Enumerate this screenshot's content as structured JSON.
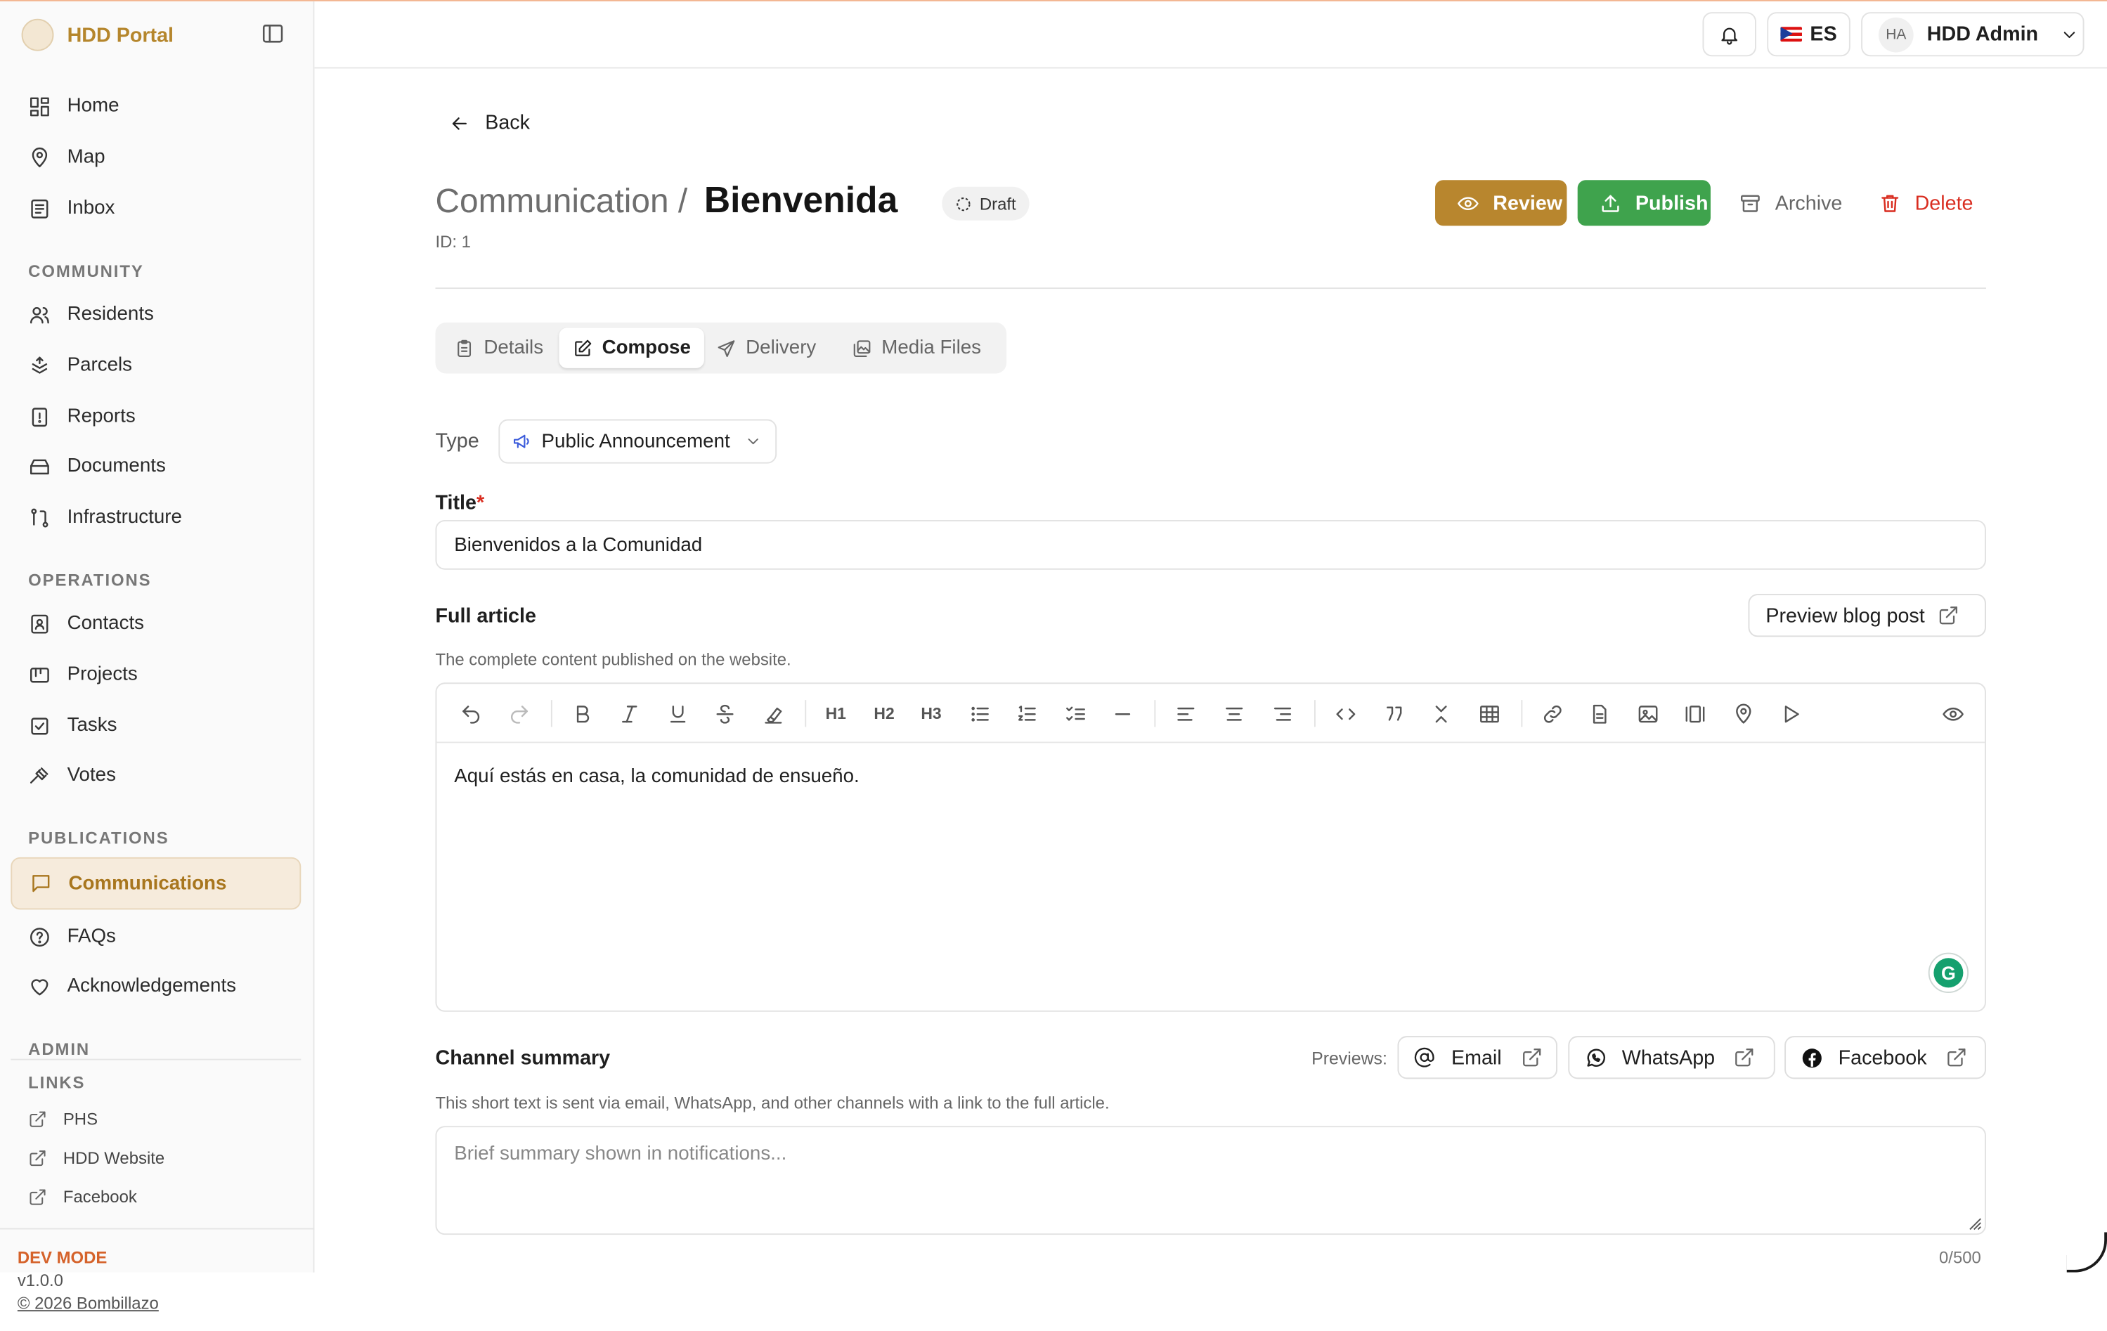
{
  "app": {
    "brand": "HDD Portal",
    "accent": "#b5862c",
    "dev_mode": "DEV MODE",
    "version": "v1.0.0",
    "copyright": "© 2026 Bombillazo"
  },
  "sidebar": {
    "main": [
      {
        "label": "Home",
        "icon": "home-icon"
      },
      {
        "label": "Map",
        "icon": "map-pin-icon"
      },
      {
        "label": "Inbox",
        "icon": "inbox-icon"
      }
    ],
    "community_label": "COMMUNITY",
    "community": [
      {
        "label": "Residents",
        "icon": "users-icon"
      },
      {
        "label": "Parcels",
        "icon": "parcels-icon"
      },
      {
        "label": "Reports",
        "icon": "report-icon"
      },
      {
        "label": "Documents",
        "icon": "documents-icon"
      },
      {
        "label": "Infrastructure",
        "icon": "infrastructure-icon"
      }
    ],
    "operations_label": "OPERATIONS",
    "operations": [
      {
        "label": "Contacts",
        "icon": "contacts-icon"
      },
      {
        "label": "Projects",
        "icon": "projects-icon"
      },
      {
        "label": "Tasks",
        "icon": "tasks-icon"
      },
      {
        "label": "Votes",
        "icon": "gavel-icon"
      }
    ],
    "publications_label": "PUBLICATIONS",
    "publications": [
      {
        "label": "Communications",
        "icon": "message-icon",
        "active": true
      },
      {
        "label": "FAQs",
        "icon": "help-icon"
      },
      {
        "label": "Acknowledgements",
        "icon": "heart-icon"
      }
    ],
    "admin_label": "ADMIN",
    "links_label": "LINKS",
    "links": [
      {
        "label": "PHS",
        "icon": "external-link-icon"
      },
      {
        "label": "HDD Website",
        "icon": "external-link-icon"
      },
      {
        "label": "Facebook",
        "icon": "external-link-icon"
      }
    ]
  },
  "topbar": {
    "language": "ES",
    "user_initials": "HA",
    "user_name": "HDD Admin"
  },
  "page": {
    "back": "Back",
    "breadcrumb": "Communication /",
    "title": "Bienvenida",
    "status": "Draft",
    "id_label": "ID: 1",
    "actions": {
      "review": "Review",
      "publish": "Publish",
      "archive": "Archive",
      "delete": "Delete"
    },
    "action_colors": {
      "review": "#b8862e",
      "publish": "#3fa34d",
      "delete": "#d92d20"
    }
  },
  "tabs": [
    {
      "label": "Details",
      "icon": "clipboard-icon"
    },
    {
      "label": "Compose",
      "icon": "edit-icon",
      "active": true
    },
    {
      "label": "Delivery",
      "icon": "send-icon"
    },
    {
      "label": "Media Files",
      "icon": "images-icon"
    }
  ],
  "form": {
    "type_label": "Type",
    "type_value": "Public Announcement",
    "title_label": "Title",
    "required_mark": "*",
    "title_value": "Bienvenidos a la Comunidad",
    "article_label": "Full article",
    "article_help": "The complete content published on the website.",
    "preview_blog": "Preview blog post",
    "article_body": "Aquí estás en casa, la comunidad de ensueño.",
    "heading_buttons": [
      "H1",
      "H2",
      "H3"
    ],
    "summary_label": "Channel summary",
    "previews_label": "Previews:",
    "preview_channels": [
      "Email",
      "WhatsApp",
      "Facebook"
    ],
    "summary_help": "This short text is sent via email, WhatsApp, and other channels with a link to the full article.",
    "summary_placeholder": "Brief summary shown in notifications...",
    "char_count": "0/500"
  }
}
